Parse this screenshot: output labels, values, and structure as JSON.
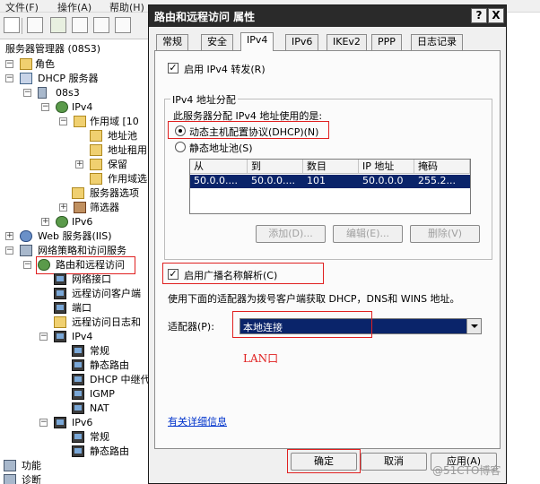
{
  "menubar": {
    "file": "文件(F)",
    "action": "操作(A)",
    "help": "帮助(H)"
  },
  "tree": {
    "root": "服务器管理器 (08S3)",
    "roles": "角色",
    "dhcp": "DHCP 服务器",
    "host": "08s3",
    "ipv4": "IPv4",
    "scope": "作用域 [10",
    "pool": "地址池",
    "lease": "地址租用",
    "reserve": "保留",
    "scope_options": "作用域选",
    "server_options": "服务器选项",
    "filters": "筛选器",
    "ipv6": "IPv6",
    "web": "Web 服务器(IIS)",
    "nps": "网络策略和访问服务",
    "rras": "路由和远程访问",
    "nic": "网络接口",
    "clients": "远程访问客户端",
    "ports": "端口",
    "logging": "远程访问日志和",
    "r_ipv4": "IPv4",
    "general": "常规",
    "static": "静态路由",
    "dhcp_relay": "DHCP 中继代",
    "igmp": "IGMP",
    "nat": "NAT",
    "r_ipv6": "IPv6",
    "general6": "常规",
    "static6": "静态路由",
    "features": "功能",
    "diagnostics": "诊断"
  },
  "dialog": {
    "title": "路由和远程访问 属性",
    "help_btn": "?",
    "close_btn": "X",
    "tabs": [
      "常规",
      "安全",
      "IPv4",
      "IPv6",
      "IKEv2",
      "PPP",
      "日志记录"
    ],
    "enable_ipv4_forwarding": "启用 IPv4 转发(R)",
    "group_title": "IPv4 地址分配",
    "assign_text": "此服务器分配 IPv4 地址使用的是:",
    "radio_dhcp": "动态主机配置协议(DHCP)(N)",
    "radio_static": "静态地址池(S)",
    "table": {
      "headers": [
        "从",
        "到",
        "数目",
        "IP 地址",
        "掩码"
      ],
      "row": [
        "50.0.0....",
        "50.0.0....",
        "101",
        "50.0.0.0",
        "255.2..."
      ]
    },
    "btn_add": "添加(D)...",
    "btn_edit": "编辑(E)...",
    "btn_delete": "删除(V)",
    "enable_broadcast": "启用广播名称解析(C)",
    "adapter_desc": "使用下面的适配器为拨号客户端获取 DHCP，DNS和 WINS 地址。",
    "adapter_label": "适配器(P):",
    "adapter_value": "本地连接",
    "annotation": "LAN口",
    "more_info": "有关详细信息",
    "ok": "确定",
    "cancel": "取消",
    "apply": "应用(A)"
  },
  "watermark": "@51CTO博客",
  "colors": {
    "selection": "#0a246a",
    "annotation_red": "#e02020",
    "link_blue": "#0033cc"
  }
}
